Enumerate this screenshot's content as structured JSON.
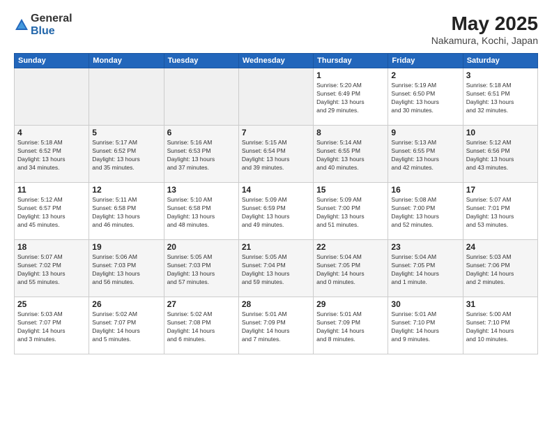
{
  "header": {
    "logo_general": "General",
    "logo_blue": "Blue",
    "month_title": "May 2025",
    "location": "Nakamura, Kochi, Japan"
  },
  "weekdays": [
    "Sunday",
    "Monday",
    "Tuesday",
    "Wednesday",
    "Thursday",
    "Friday",
    "Saturday"
  ],
  "weeks": [
    [
      {
        "day": "",
        "info": ""
      },
      {
        "day": "",
        "info": ""
      },
      {
        "day": "",
        "info": ""
      },
      {
        "day": "",
        "info": ""
      },
      {
        "day": "1",
        "info": "Sunrise: 5:20 AM\nSunset: 6:49 PM\nDaylight: 13 hours\nand 29 minutes."
      },
      {
        "day": "2",
        "info": "Sunrise: 5:19 AM\nSunset: 6:50 PM\nDaylight: 13 hours\nand 30 minutes."
      },
      {
        "day": "3",
        "info": "Sunrise: 5:18 AM\nSunset: 6:51 PM\nDaylight: 13 hours\nand 32 minutes."
      }
    ],
    [
      {
        "day": "4",
        "info": "Sunrise: 5:18 AM\nSunset: 6:52 PM\nDaylight: 13 hours\nand 34 minutes."
      },
      {
        "day": "5",
        "info": "Sunrise: 5:17 AM\nSunset: 6:52 PM\nDaylight: 13 hours\nand 35 minutes."
      },
      {
        "day": "6",
        "info": "Sunrise: 5:16 AM\nSunset: 6:53 PM\nDaylight: 13 hours\nand 37 minutes."
      },
      {
        "day": "7",
        "info": "Sunrise: 5:15 AM\nSunset: 6:54 PM\nDaylight: 13 hours\nand 39 minutes."
      },
      {
        "day": "8",
        "info": "Sunrise: 5:14 AM\nSunset: 6:55 PM\nDaylight: 13 hours\nand 40 minutes."
      },
      {
        "day": "9",
        "info": "Sunrise: 5:13 AM\nSunset: 6:55 PM\nDaylight: 13 hours\nand 42 minutes."
      },
      {
        "day": "10",
        "info": "Sunrise: 5:12 AM\nSunset: 6:56 PM\nDaylight: 13 hours\nand 43 minutes."
      }
    ],
    [
      {
        "day": "11",
        "info": "Sunrise: 5:12 AM\nSunset: 6:57 PM\nDaylight: 13 hours\nand 45 minutes."
      },
      {
        "day": "12",
        "info": "Sunrise: 5:11 AM\nSunset: 6:58 PM\nDaylight: 13 hours\nand 46 minutes."
      },
      {
        "day": "13",
        "info": "Sunrise: 5:10 AM\nSunset: 6:58 PM\nDaylight: 13 hours\nand 48 minutes."
      },
      {
        "day": "14",
        "info": "Sunrise: 5:09 AM\nSunset: 6:59 PM\nDaylight: 13 hours\nand 49 minutes."
      },
      {
        "day": "15",
        "info": "Sunrise: 5:09 AM\nSunset: 7:00 PM\nDaylight: 13 hours\nand 51 minutes."
      },
      {
        "day": "16",
        "info": "Sunrise: 5:08 AM\nSunset: 7:00 PM\nDaylight: 13 hours\nand 52 minutes."
      },
      {
        "day": "17",
        "info": "Sunrise: 5:07 AM\nSunset: 7:01 PM\nDaylight: 13 hours\nand 53 minutes."
      }
    ],
    [
      {
        "day": "18",
        "info": "Sunrise: 5:07 AM\nSunset: 7:02 PM\nDaylight: 13 hours\nand 55 minutes."
      },
      {
        "day": "19",
        "info": "Sunrise: 5:06 AM\nSunset: 7:03 PM\nDaylight: 13 hours\nand 56 minutes."
      },
      {
        "day": "20",
        "info": "Sunrise: 5:05 AM\nSunset: 7:03 PM\nDaylight: 13 hours\nand 57 minutes."
      },
      {
        "day": "21",
        "info": "Sunrise: 5:05 AM\nSunset: 7:04 PM\nDaylight: 13 hours\nand 59 minutes."
      },
      {
        "day": "22",
        "info": "Sunrise: 5:04 AM\nSunset: 7:05 PM\nDaylight: 14 hours\nand 0 minutes."
      },
      {
        "day": "23",
        "info": "Sunrise: 5:04 AM\nSunset: 7:05 PM\nDaylight: 14 hours\nand 1 minute."
      },
      {
        "day": "24",
        "info": "Sunrise: 5:03 AM\nSunset: 7:06 PM\nDaylight: 14 hours\nand 2 minutes."
      }
    ],
    [
      {
        "day": "25",
        "info": "Sunrise: 5:03 AM\nSunset: 7:07 PM\nDaylight: 14 hours\nand 3 minutes."
      },
      {
        "day": "26",
        "info": "Sunrise: 5:02 AM\nSunset: 7:07 PM\nDaylight: 14 hours\nand 5 minutes."
      },
      {
        "day": "27",
        "info": "Sunrise: 5:02 AM\nSunset: 7:08 PM\nDaylight: 14 hours\nand 6 minutes."
      },
      {
        "day": "28",
        "info": "Sunrise: 5:01 AM\nSunset: 7:09 PM\nDaylight: 14 hours\nand 7 minutes."
      },
      {
        "day": "29",
        "info": "Sunrise: 5:01 AM\nSunset: 7:09 PM\nDaylight: 14 hours\nand 8 minutes."
      },
      {
        "day": "30",
        "info": "Sunrise: 5:01 AM\nSunset: 7:10 PM\nDaylight: 14 hours\nand 9 minutes."
      },
      {
        "day": "31",
        "info": "Sunrise: 5:00 AM\nSunset: 7:10 PM\nDaylight: 14 hours\nand 10 minutes."
      }
    ]
  ]
}
